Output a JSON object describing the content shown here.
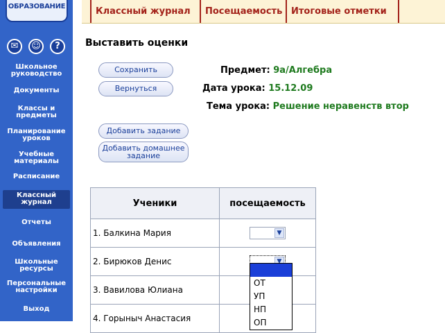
{
  "sidebar": {
    "logo_text": "ОБРАЗОВАНИЕ",
    "icons": [
      "mail-icon",
      "users-icon",
      "help-icon"
    ],
    "help_glyph": "?",
    "items": [
      {
        "label": "Школьное руководство"
      },
      {
        "label": "Документы"
      },
      {
        "label": "Классы и предметы"
      },
      {
        "label": "Планирование уроков"
      },
      {
        "label": "Учебные материалы"
      },
      {
        "label": "Расписание"
      },
      {
        "label": "Классный журнал",
        "active": true
      },
      {
        "label": "Отчеты"
      },
      {
        "label": "Объявления"
      },
      {
        "label": "Школьные ресурсы"
      },
      {
        "label": "Персональные настройки"
      },
      {
        "label": "Выход"
      }
    ]
  },
  "tabs": [
    "Классный журнал",
    "Посещаемость",
    "Итоговые отметки"
  ],
  "page_title": "Выставить оценки",
  "buttons": {
    "save": "Сохранить",
    "back": "Вернуться",
    "add_task": "Добавить задание",
    "add_homework": "Добавить домашнее задание"
  },
  "lesson": {
    "subject_label": "Предмет:",
    "subject_value": "9а/Алгебра",
    "date_label": "Дата урока:",
    "date_value": "15.12.09",
    "topic_label": "Тема урока:",
    "topic_value": "Решение неравенств втор"
  },
  "table": {
    "headers": [
      "Ученики",
      "посещаемость"
    ],
    "rows": [
      {
        "name": "1. Балкина Мария"
      },
      {
        "name": "2. Бирюков Денис"
      },
      {
        "name": "3. Вавилова Юлиана"
      },
      {
        "name": "4. Горыныч Анастасия"
      }
    ]
  },
  "attendance_options": [
    "",
    "ОТ",
    "УП",
    "НП",
    "ОП"
  ],
  "colors": {
    "sidebar": "#3264c8",
    "tab_text": "#a3221a",
    "value_green": "#1e7a1e",
    "highlight": "#1a3fd8"
  }
}
